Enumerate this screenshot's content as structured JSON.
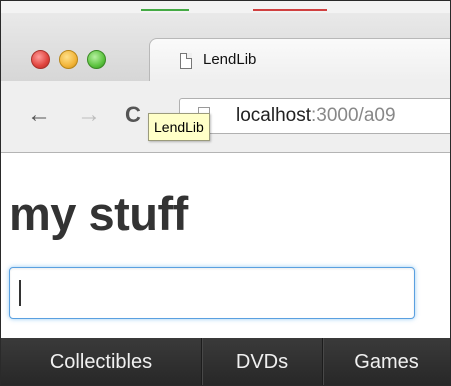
{
  "browser": {
    "tab_title": "LendLib",
    "url_host": "localhost",
    "url_path": ":3000/a09",
    "tooltip": "LendLib"
  },
  "page": {
    "heading": "my stuff",
    "search_value": "",
    "categories": [
      "Collectibles",
      "DVDs",
      "Games"
    ]
  },
  "colors": {
    "category_bar": "#2e2e2e",
    "input_focus": "#52a8ec"
  }
}
